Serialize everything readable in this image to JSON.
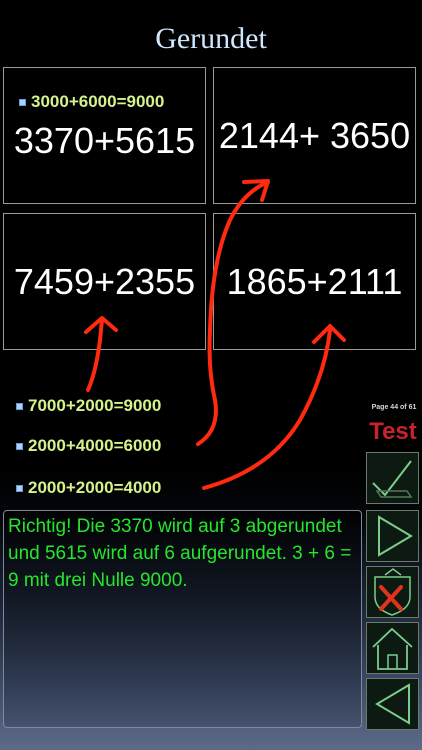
{
  "header": {
    "title": "Gerundet"
  },
  "cards": [
    {
      "expression": "3370+5615",
      "hint": "3000+6000=9000"
    },
    {
      "expression": "2144+ 3650"
    },
    {
      "expression": "7459+2355"
    },
    {
      "expression": "1865+2111"
    }
  ],
  "hints": [
    "7000+2000=9000",
    "2000+4000=6000",
    "2000+2000=4000"
  ],
  "sidebar": {
    "page_indicator": "Page 44 of 61",
    "mode_label": "Test",
    "buttons": [
      "check-icon",
      "play-icon",
      "shield-cancel-icon",
      "home-icon",
      "back-icon"
    ]
  },
  "feedback": {
    "text": "Richtig! Die 3370 wird auf 3 abgerundet und 5615 wird auf 6 aufgerundet. 3 + 6 = 9 mit drei Nulle 9000."
  },
  "colors": {
    "title": "#cfe6ff",
    "hint": "#d6f28c",
    "feedback": "#26e62c",
    "annotation": "#ff2a10",
    "test_label": "#c8222a"
  }
}
